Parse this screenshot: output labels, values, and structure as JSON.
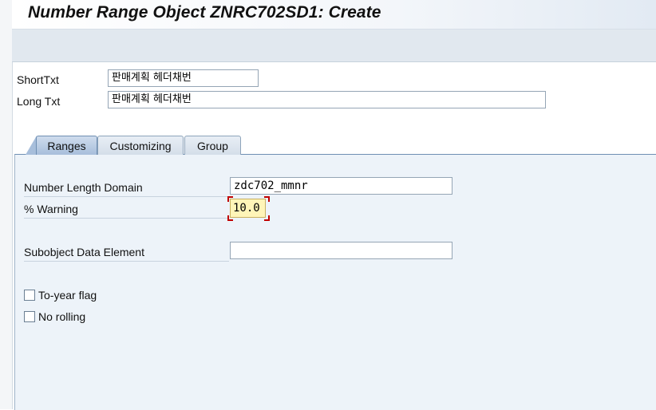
{
  "title": "Number Range Object ZNRC702SD1: Create",
  "header_fields": {
    "short_txt_label": "ShortTxt",
    "short_txt_value": "판매계획 헤더채번",
    "long_txt_label": "Long Txt",
    "long_txt_value": "판매계획 헤더채번"
  },
  "tabs": [
    {
      "label": "Ranges",
      "active": true
    },
    {
      "label": "Customizing",
      "active": false
    },
    {
      "label": "Group",
      "active": false
    }
  ],
  "ranges": {
    "number_length_domain_label": "Number Length Domain",
    "number_length_domain_value": "zdc702_mmnr",
    "warning_label": "% Warning",
    "warning_value": "10.0",
    "subobject_label": "Subobject Data Element",
    "subobject_value": "",
    "to_year_flag_label": "To-year flag",
    "to_year_flag_checked": false,
    "no_rolling_label": "No rolling",
    "no_rolling_checked": false
  },
  "colors": {
    "toolbar": "#e1e8ef",
    "tab_panel": "#edf3f9",
    "active_tab": "#a7bedb",
    "warning_highlight": "#fff5b8",
    "focus_corner": "#c00000"
  }
}
